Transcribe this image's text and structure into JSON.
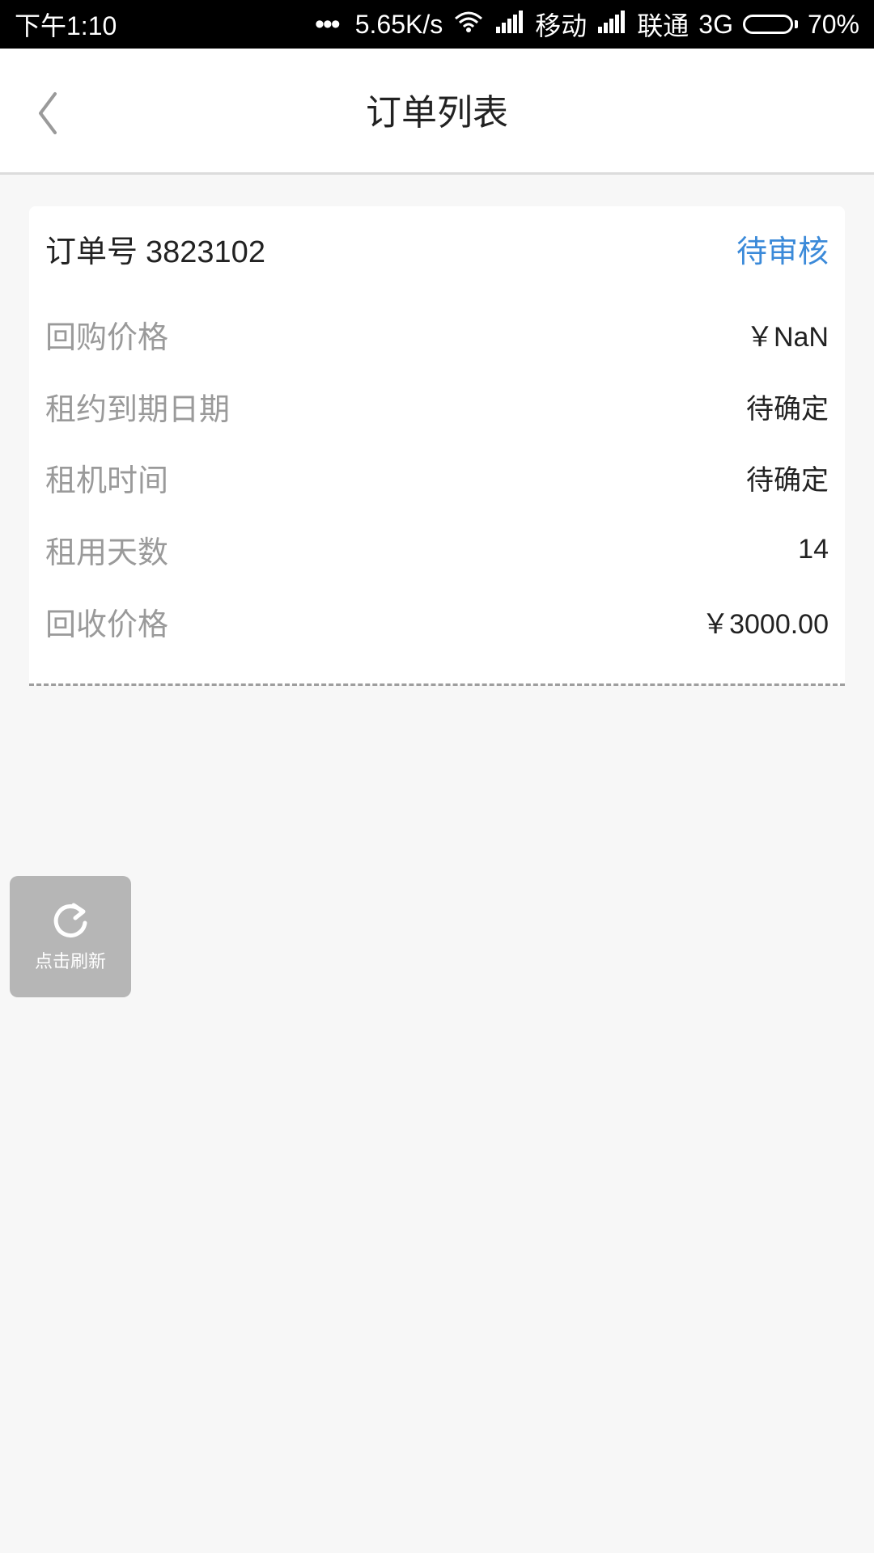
{
  "status_bar": {
    "time": "下午1:10",
    "dots": "•••",
    "speed": "5.65K/s",
    "carrier1": "移动",
    "carrier2": "联通",
    "network": "3G",
    "battery_level": 70,
    "battery_text": "70%"
  },
  "header": {
    "title": "订单列表",
    "back_icon": "chevron-left-icon"
  },
  "order": {
    "order_no_label": "订单号",
    "order_no": "3823102",
    "status": "待审核",
    "status_color": "#3b8ad9",
    "rows": [
      {
        "label": "回购价格",
        "value": "￥NaN"
      },
      {
        "label": "租约到期日期",
        "value": "待确定"
      },
      {
        "label": "租机时间",
        "value": "待确定"
      },
      {
        "label": "租用天数",
        "value": "14"
      },
      {
        "label": "回收价格",
        "value": "￥3000.00"
      }
    ]
  },
  "refresh": {
    "label": "点击刷新",
    "icon": "refresh-icon"
  }
}
